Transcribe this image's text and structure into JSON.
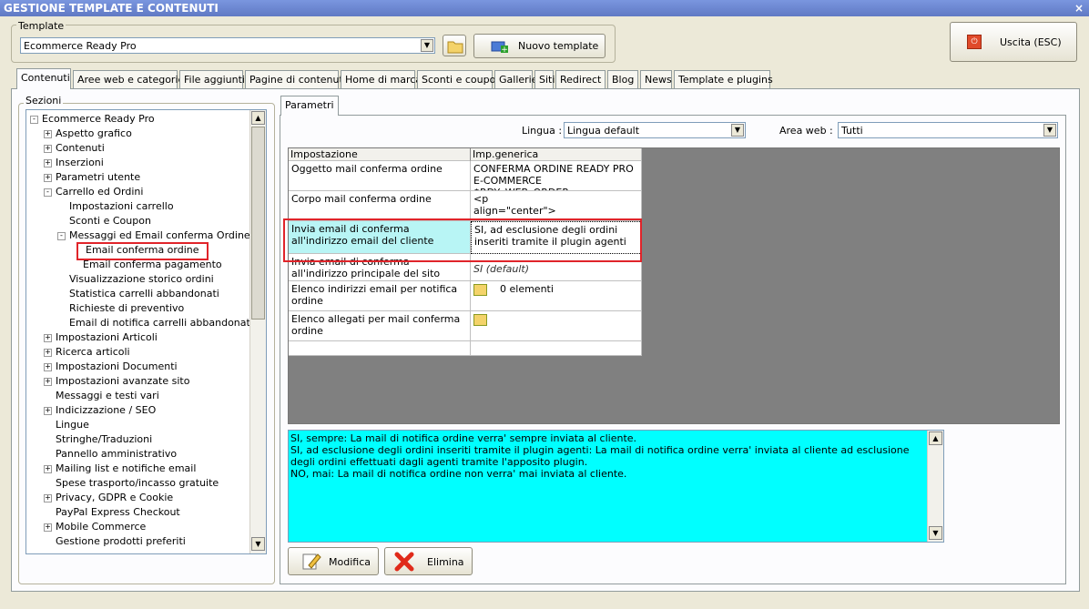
{
  "window": {
    "title": "GESTIONE TEMPLATE E CONTENUTI",
    "close": "×"
  },
  "template_group": {
    "label": "Template",
    "selected": "Ecommerce Ready Pro",
    "new_template_label": "Nuovo template"
  },
  "exit_button": {
    "label": "Uscita (ESC)"
  },
  "tabs": [
    "Contenuti",
    "Aree web e categorie",
    "File aggiuntivi",
    "Pagine di contenuti",
    "Home di marca",
    "Sconti e coupon",
    "Gallerie",
    "Siti",
    "Redirect",
    "Blog",
    "News",
    "Template e plugins"
  ],
  "sections": {
    "label": "Sezioni"
  },
  "tree": [
    {
      "label": "Ecommerce Ready Pro",
      "level": 0,
      "toggle": "−"
    },
    {
      "label": "Aspetto grafico",
      "level": 1,
      "toggle": "+"
    },
    {
      "label": "Contenuti",
      "level": 1,
      "toggle": "+"
    },
    {
      "label": "Inserzioni",
      "level": 1,
      "toggle": "+"
    },
    {
      "label": "Parametri utente",
      "level": 1,
      "toggle": "+"
    },
    {
      "label": "Carrello ed Ordini",
      "level": 1,
      "toggle": "−"
    },
    {
      "label": "Impostazioni carrello",
      "level": 2,
      "toggle": ""
    },
    {
      "label": "Sconti e Coupon",
      "level": 2,
      "toggle": ""
    },
    {
      "label": "Messaggi ed Email conferma Ordine",
      "level": 2,
      "toggle": "−"
    },
    {
      "label": "Email conferma ordine",
      "level": 3,
      "toggle": "",
      "selected": true
    },
    {
      "label": "Email conferma pagamento",
      "level": 3,
      "toggle": ""
    },
    {
      "label": "Visualizzazione storico ordini",
      "level": 2,
      "toggle": ""
    },
    {
      "label": "Statistica carrelli abbandonati",
      "level": 2,
      "toggle": ""
    },
    {
      "label": "Richieste di preventivo",
      "level": 2,
      "toggle": ""
    },
    {
      "label": "Email di notifica carrelli abbandonati",
      "level": 2,
      "toggle": ""
    },
    {
      "label": "Impostazioni Articoli",
      "level": 1,
      "toggle": "+"
    },
    {
      "label": "Ricerca articoli",
      "level": 1,
      "toggle": "+"
    },
    {
      "label": "Impostazioni Documenti",
      "level": 1,
      "toggle": "+"
    },
    {
      "label": "Impostazioni avanzate sito",
      "level": 1,
      "toggle": "+"
    },
    {
      "label": "Messaggi e testi vari",
      "level": 1,
      "toggle": ""
    },
    {
      "label": "Indicizzazione / SEO",
      "level": 1,
      "toggle": "+"
    },
    {
      "label": "Lingue",
      "level": 1,
      "toggle": ""
    },
    {
      "label": "Stringhe/Traduzioni",
      "level": 1,
      "toggle": ""
    },
    {
      "label": "Pannello amministrativo",
      "level": 1,
      "toggle": ""
    },
    {
      "label": "Mailing list e notifiche email",
      "level": 1,
      "toggle": "+"
    },
    {
      "label": "Spese trasporto/incasso gratuite",
      "level": 1,
      "toggle": ""
    },
    {
      "label": "Privacy, GDPR e Cookie",
      "level": 1,
      "toggle": "+"
    },
    {
      "label": "PayPal Express Checkout",
      "level": 1,
      "toggle": ""
    },
    {
      "label": "Mobile Commerce",
      "level": 1,
      "toggle": "+"
    },
    {
      "label": "Gestione prodotti preferiti",
      "level": 1,
      "toggle": ""
    }
  ],
  "params_tab": {
    "label": "Parametri"
  },
  "lingua": {
    "label": "Lingua :",
    "value": "Lingua default"
  },
  "area_web": {
    "label": "Area web :",
    "value": "Tutti"
  },
  "grid": {
    "headers": [
      "Impostazione",
      "Imp.generica"
    ],
    "rows": [
      {
        "setting": "Oggetto mail conferma ordine",
        "value": "CONFERMA ORDINE READY PRO\nE-COMMERCE $RDY_WEB_ORDER..."
      },
      {
        "setting": "Corpo mail conferma ordine",
        "value": "<p\nalign=\"center\"><strong>QUESTO E'"
      },
      {
        "setting": "Invia email di conferma all'indirizzo email del cliente",
        "value": "SI, ad esclusione degli ordini inseriti tramite il plugin agenti"
      },
      {
        "setting": "Invia email di conferma all'indirizzo principale del sito",
        "value": "SI (default)"
      },
      {
        "setting": "Elenco indirizzi email per notifica ordine",
        "value": "0 elementi"
      },
      {
        "setting": "Elenco allegati per mail conferma ordine",
        "value": ""
      }
    ]
  },
  "help_text": "SI, sempre: La mail di notifica ordine verra' sempre inviata al cliente.\nSI, ad esclusione degli ordini inseriti tramite il plugin agenti: La mail di notifica ordine verra' inviata al cliente ad esclusione degli ordini effettuati dagli agenti tramite l'apposito plugin.\nNO, mai: La mail di notifica ordine non verra' mai inviata al cliente.",
  "actions": {
    "edit": "Modifica",
    "delete": "Elimina"
  },
  "colors": {
    "highlight": "#e0242a",
    "selected_row": "#b8f5f5",
    "help_bg": "#00ffff",
    "grid_bg": "#808080"
  }
}
